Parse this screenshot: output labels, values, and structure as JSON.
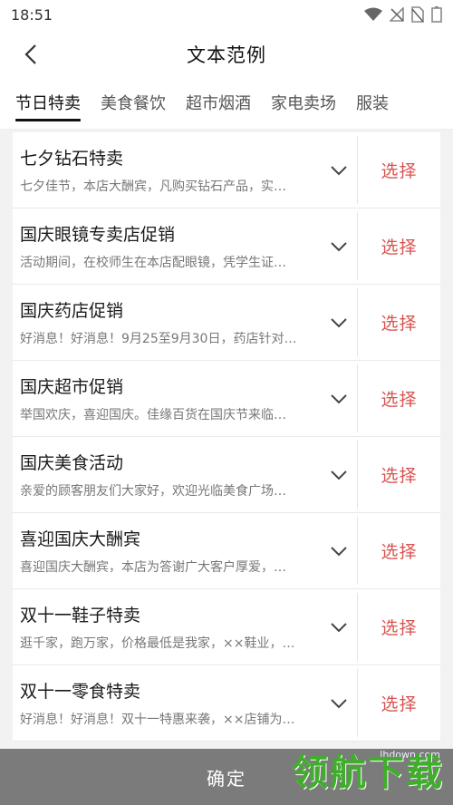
{
  "status": {
    "time": "18:51"
  },
  "nav": {
    "title": "文本范例"
  },
  "tabs": [
    "节日特卖",
    "美食餐饮",
    "超市烟酒",
    "家电卖场",
    "服装"
  ],
  "items": [
    {
      "title": "七夕钻石特卖",
      "desc": "七夕佳节，本店大酬宾，凡购买钻石产品，实…",
      "action": "选择"
    },
    {
      "title": "国庆眼镜专卖店促销",
      "desc": "活动期间，在校师生在本店配眼镜，凭学生证…",
      "action": "选择"
    },
    {
      "title": "国庆药店促销",
      "desc": "好消息！好消息！9月25至9月30日，药店针对…",
      "action": "选择"
    },
    {
      "title": "国庆超市促销",
      "desc": "举国欢庆，喜迎国庆。佳缘百货在国庆节来临…",
      "action": "选择"
    },
    {
      "title": "国庆美食活动",
      "desc": "亲爱的顾客朋友们大家好，欢迎光临美食广场…",
      "action": "选择"
    },
    {
      "title": "喜迎国庆大酬宾",
      "desc": "喜迎国庆大酬宾，本店为答谢广大客户厚爱，…",
      "action": "选择"
    },
    {
      "title": "双十一鞋子特卖",
      "desc": "逛千家，跑万家，价格最低是我家，××鞋业，…",
      "action": "选择"
    },
    {
      "title": "双十一零食特卖",
      "desc": "好消息！好消息！双十一特惠来袭，××店铺为…",
      "action": "选择"
    }
  ],
  "confirm_label": "确定",
  "watermark": {
    "text": "领航下载",
    "url": "lhdown.com"
  },
  "colors": {
    "select": "#d9534f",
    "confirm_bg": "#7b7b7b",
    "watermark": "#3fae2a"
  }
}
